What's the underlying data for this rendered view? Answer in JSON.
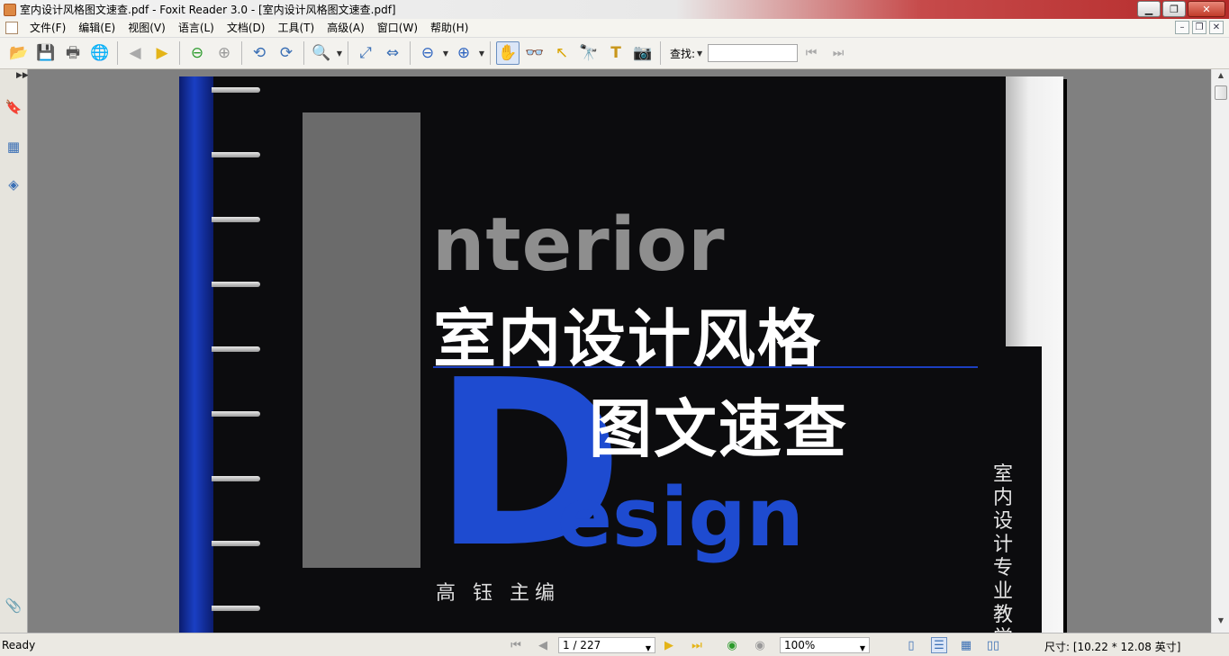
{
  "window": {
    "title": "室内设计风格图文速查.pdf - Foxit Reader 3.0 - [室内设计风格图文速查.pdf]",
    "min_icon": "minimize-icon",
    "max_icon": "restore-icon",
    "close_label": "✕"
  },
  "menu": {
    "items": [
      "文件(F)",
      "编辑(E)",
      "视图(V)",
      "语言(L)",
      "文档(D)",
      "工具(T)",
      "高级(A)",
      "窗口(W)",
      "帮助(H)"
    ]
  },
  "toolbar": {
    "find_label": "查找:",
    "find_value": ""
  },
  "document": {
    "cover_word": "nterior",
    "title_cn": "室内设计风格",
    "big_letter": "D",
    "subtitle_cn": "图文速查",
    "word_rest": "esign",
    "author": "高 钰  主编",
    "vertical_text": "室内设计专业教学"
  },
  "status": {
    "ready": "Ready",
    "page_display": "1 / 227",
    "zoom": "100%",
    "size": "尺寸: [10.22 * 12.08 英寸]"
  },
  "colors": {
    "cover_blue": "#1e4bd0",
    "cover_bg": "#0c0c0e"
  }
}
